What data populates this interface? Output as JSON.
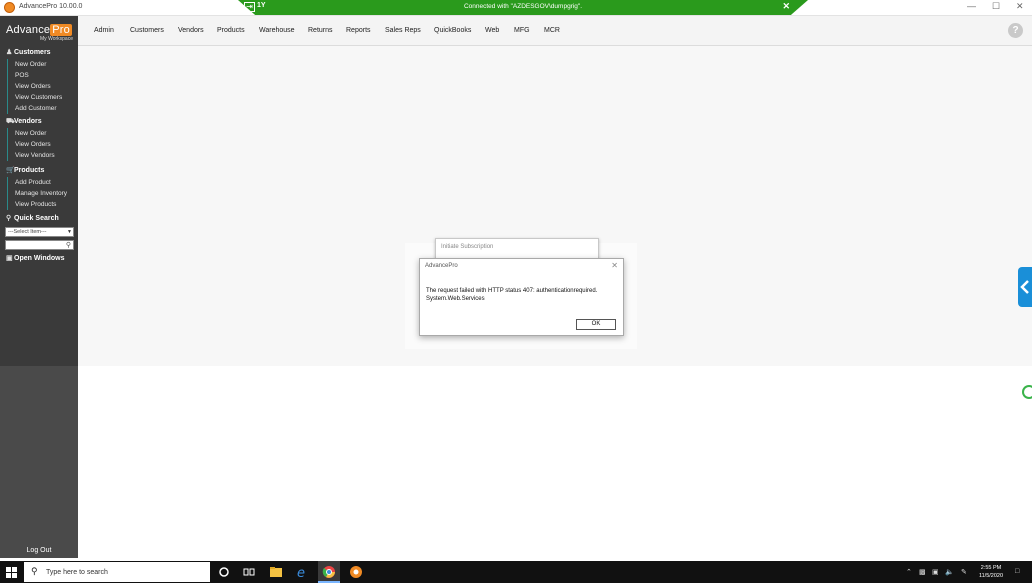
{
  "window": {
    "title": "AdvancePro 10.00.0",
    "connection_text": "Connected with \"AZDESGOV\\dumpgrig\".",
    "pin_label": "1Y",
    "conn_close": "✕",
    "min": "—",
    "max": "☐",
    "close": "✕"
  },
  "logo": {
    "brand": "Advance",
    "brand_pro": "Pro",
    "workspace": "My Workspace"
  },
  "topnav": {
    "items": [
      "Admin",
      "Customers",
      "Vendors",
      "Products",
      "Warehouse",
      "Returns",
      "Reports",
      "Sales Reps",
      "QuickBooks",
      "Web",
      "MFG",
      "MCR"
    ],
    "help": "?"
  },
  "sidebar": {
    "customers": {
      "title": "Customers",
      "links": [
        "New Order",
        "POS",
        "View Orders",
        "View Customers",
        "Add Customer"
      ]
    },
    "vendors": {
      "title": "Vendors",
      "links": [
        "New Order",
        "View Orders",
        "View Vendors"
      ]
    },
    "products": {
      "title": "Products",
      "links": [
        "Add Product",
        "Manage Inventory",
        "View Products"
      ]
    },
    "quick_search": {
      "title": "Quick Search",
      "select_value": "---Select Item---"
    },
    "open_windows": {
      "title": "Open Windows"
    },
    "logout": "Log Out"
  },
  "background_window": {
    "title": "Initiate Subscription"
  },
  "dialog": {
    "title": "AdvancePro",
    "close": "✕",
    "message": "The request failed with HTTP status 407: authenticationrequired.\nSystem.Web.Services",
    "ok": "OK"
  },
  "taskbar": {
    "search_placeholder": "Type here to search",
    "time": "2:55 PM",
    "date": "11/5/2020"
  },
  "colors": {
    "connection_bar": "#2a9a1c",
    "brand_accent": "#f08a24",
    "sidebar_bg": "#3a3a3a",
    "side_tab": "#1a8fd8"
  }
}
